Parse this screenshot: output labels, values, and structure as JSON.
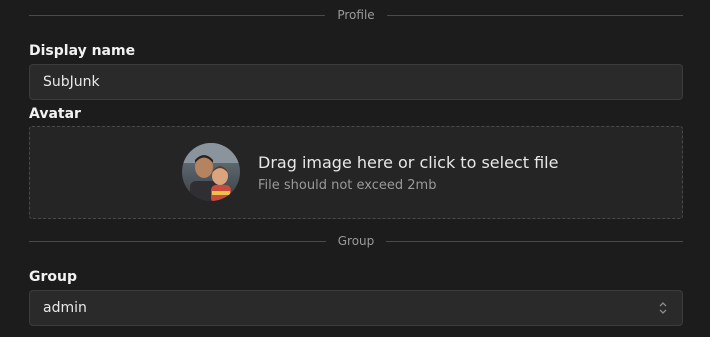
{
  "profile_section": {
    "divider_label": "Profile",
    "display_name_label": "Display name",
    "display_name_value": "SubJunk",
    "avatar_label": "Avatar",
    "dropzone_title": "Drag image here or click to select file",
    "dropzone_subtitle": "File should not exceed 2mb"
  },
  "group_section": {
    "divider_label": "Group",
    "group_label": "Group",
    "group_value": "admin"
  },
  "colors": {
    "background": "#1c1c1c",
    "input_bg": "#2a2a2a",
    "border": "#3c3c3c",
    "muted_text": "#9a9a9a"
  },
  "icons": [
    "avatar-photo",
    "chevron-up-down-icon"
  ]
}
